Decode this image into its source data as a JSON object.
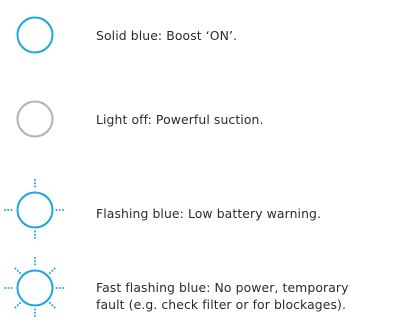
{
  "colors": {
    "blue": "#1ea4e0",
    "grey": "#b2b2b2",
    "text": "#2b2b2b"
  },
  "legend": [
    {
      "icon": "solid-blue-ring-icon",
      "text": "Solid blue: Boost ‘ON’."
    },
    {
      "icon": "grey-ring-off-icon",
      "text": "Light off: Powerful suction."
    },
    {
      "icon": "flashing-blue-ring-icon",
      "text": "Flashing blue: Low battery warning."
    },
    {
      "icon": "fast-flashing-blue-ring-icon",
      "line1": "Fast flashing blue: No power, temporary",
      "line2": "fault (e.g. check filter or for blockages)."
    }
  ]
}
